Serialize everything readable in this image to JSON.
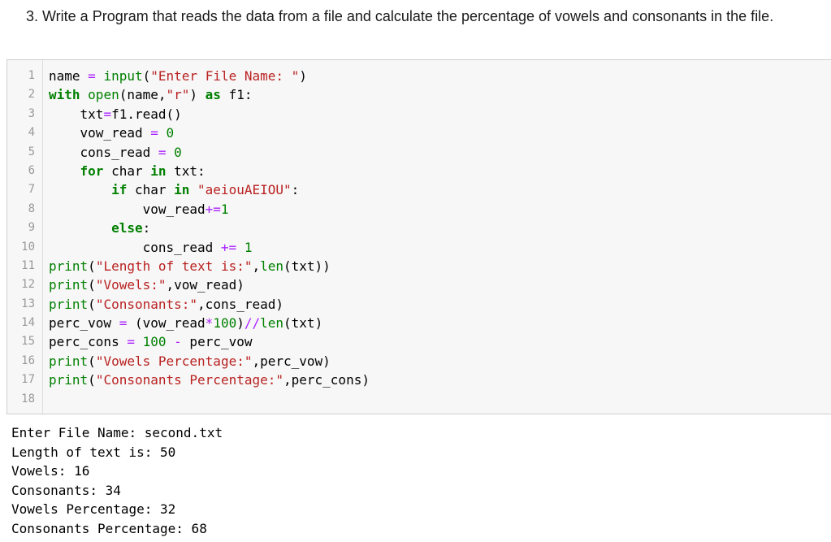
{
  "question": {
    "text": "3. Write a Program that reads the data from a file and calculate the percentage of vowels and consonants in the file."
  },
  "code_cell": {
    "line_numbers": [
      "1",
      "2",
      "3",
      "4",
      "5",
      "6",
      "7",
      "8",
      "9",
      "10",
      "11",
      "12",
      "13",
      "14",
      "15",
      "16",
      "17",
      "18"
    ],
    "lines": [
      [
        {
          "t": "name ",
          "c": ""
        },
        {
          "t": "=",
          "c": "op"
        },
        {
          "t": " ",
          "c": ""
        },
        {
          "t": "input",
          "c": "bi"
        },
        {
          "t": "(",
          "c": ""
        },
        {
          "t": "\"Enter File Name: \"",
          "c": "str"
        },
        {
          "t": ")",
          "c": ""
        }
      ],
      [
        {
          "t": "with",
          "c": "kw"
        },
        {
          "t": " ",
          "c": ""
        },
        {
          "t": "open",
          "c": "bi"
        },
        {
          "t": "(name,",
          "c": ""
        },
        {
          "t": "\"r\"",
          "c": "str"
        },
        {
          "t": ") ",
          "c": ""
        },
        {
          "t": "as",
          "c": "kw"
        },
        {
          "t": " f1:",
          "c": ""
        }
      ],
      [
        {
          "t": "    txt",
          "c": ""
        },
        {
          "t": "=",
          "c": "op"
        },
        {
          "t": "f1.read()",
          "c": ""
        }
      ],
      [
        {
          "t": "    vow_read ",
          "c": ""
        },
        {
          "t": "=",
          "c": "op"
        },
        {
          "t": " ",
          "c": ""
        },
        {
          "t": "0",
          "c": "num"
        }
      ],
      [
        {
          "t": "    cons_read ",
          "c": ""
        },
        {
          "t": "=",
          "c": "op"
        },
        {
          "t": " ",
          "c": ""
        },
        {
          "t": "0",
          "c": "num"
        }
      ],
      [
        {
          "t": "    ",
          "c": ""
        },
        {
          "t": "for",
          "c": "kw"
        },
        {
          "t": " char ",
          "c": ""
        },
        {
          "t": "in",
          "c": "kw2"
        },
        {
          "t": " txt:",
          "c": ""
        }
      ],
      [
        {
          "t": "        ",
          "c": ""
        },
        {
          "t": "if",
          "c": "kw"
        },
        {
          "t": " char ",
          "c": ""
        },
        {
          "t": "in",
          "c": "kw2"
        },
        {
          "t": " ",
          "c": ""
        },
        {
          "t": "\"aeiouAEIOU\"",
          "c": "str"
        },
        {
          "t": ":",
          "c": ""
        }
      ],
      [
        {
          "t": "            vow_read",
          "c": ""
        },
        {
          "t": "+=",
          "c": "op"
        },
        {
          "t": "1",
          "c": "num"
        }
      ],
      [
        {
          "t": "        ",
          "c": ""
        },
        {
          "t": "else",
          "c": "kw"
        },
        {
          "t": ":",
          "c": ""
        }
      ],
      [
        {
          "t": "            cons_read ",
          "c": ""
        },
        {
          "t": "+=",
          "c": "op"
        },
        {
          "t": " ",
          "c": ""
        },
        {
          "t": "1",
          "c": "num"
        }
      ],
      [
        {
          "t": "print",
          "c": "bi"
        },
        {
          "t": "(",
          "c": ""
        },
        {
          "t": "\"Length of text is:\"",
          "c": "str"
        },
        {
          "t": ",",
          "c": ""
        },
        {
          "t": "len",
          "c": "bi"
        },
        {
          "t": "(txt))",
          "c": ""
        }
      ],
      [
        {
          "t": "print",
          "c": "bi"
        },
        {
          "t": "(",
          "c": ""
        },
        {
          "t": "\"Vowels:\"",
          "c": "str"
        },
        {
          "t": ",vow_read)",
          "c": ""
        }
      ],
      [
        {
          "t": "print",
          "c": "bi"
        },
        {
          "t": "(",
          "c": ""
        },
        {
          "t": "\"Consonants:\"",
          "c": "str"
        },
        {
          "t": ",cons_read)",
          "c": ""
        }
      ],
      [
        {
          "t": "perc_vow ",
          "c": ""
        },
        {
          "t": "=",
          "c": "op"
        },
        {
          "t": " (vow_read",
          "c": ""
        },
        {
          "t": "*",
          "c": "op"
        },
        {
          "t": "100",
          "c": "num"
        },
        {
          "t": ")",
          "c": ""
        },
        {
          "t": "//",
          "c": "op"
        },
        {
          "t": "len",
          "c": "bi"
        },
        {
          "t": "(txt)",
          "c": ""
        }
      ],
      [
        {
          "t": "perc_cons ",
          "c": ""
        },
        {
          "t": "=",
          "c": "op"
        },
        {
          "t": " ",
          "c": ""
        },
        {
          "t": "100",
          "c": "num"
        },
        {
          "t": " ",
          "c": ""
        },
        {
          "t": "-",
          "c": "op"
        },
        {
          "t": " perc_vow",
          "c": ""
        }
      ],
      [
        {
          "t": "print",
          "c": "bi"
        },
        {
          "t": "(",
          "c": ""
        },
        {
          "t": "\"Vowels Percentage:\"",
          "c": "str"
        },
        {
          "t": ",perc_vow)",
          "c": ""
        }
      ],
      [
        {
          "t": "print",
          "c": "bi"
        },
        {
          "t": "(",
          "c": ""
        },
        {
          "t": "\"Consonants Percentage:\"",
          "c": "str"
        },
        {
          "t": ",perc_cons)",
          "c": ""
        }
      ],
      [
        {
          "t": "",
          "c": ""
        }
      ]
    ]
  },
  "output": {
    "lines": [
      "Enter File Name: second.txt",
      "Length of text is: 50",
      "Vowels: 16",
      "Consonants: 34",
      "Vowels Percentage: 32",
      "Consonants Percentage: 68"
    ]
  },
  "colors": {
    "keyword": "#008000",
    "operator": "#aa22ff",
    "string": "#ba2121",
    "number": "#008000",
    "cell_background": "#f7f7f7",
    "line_number": "#999999"
  }
}
